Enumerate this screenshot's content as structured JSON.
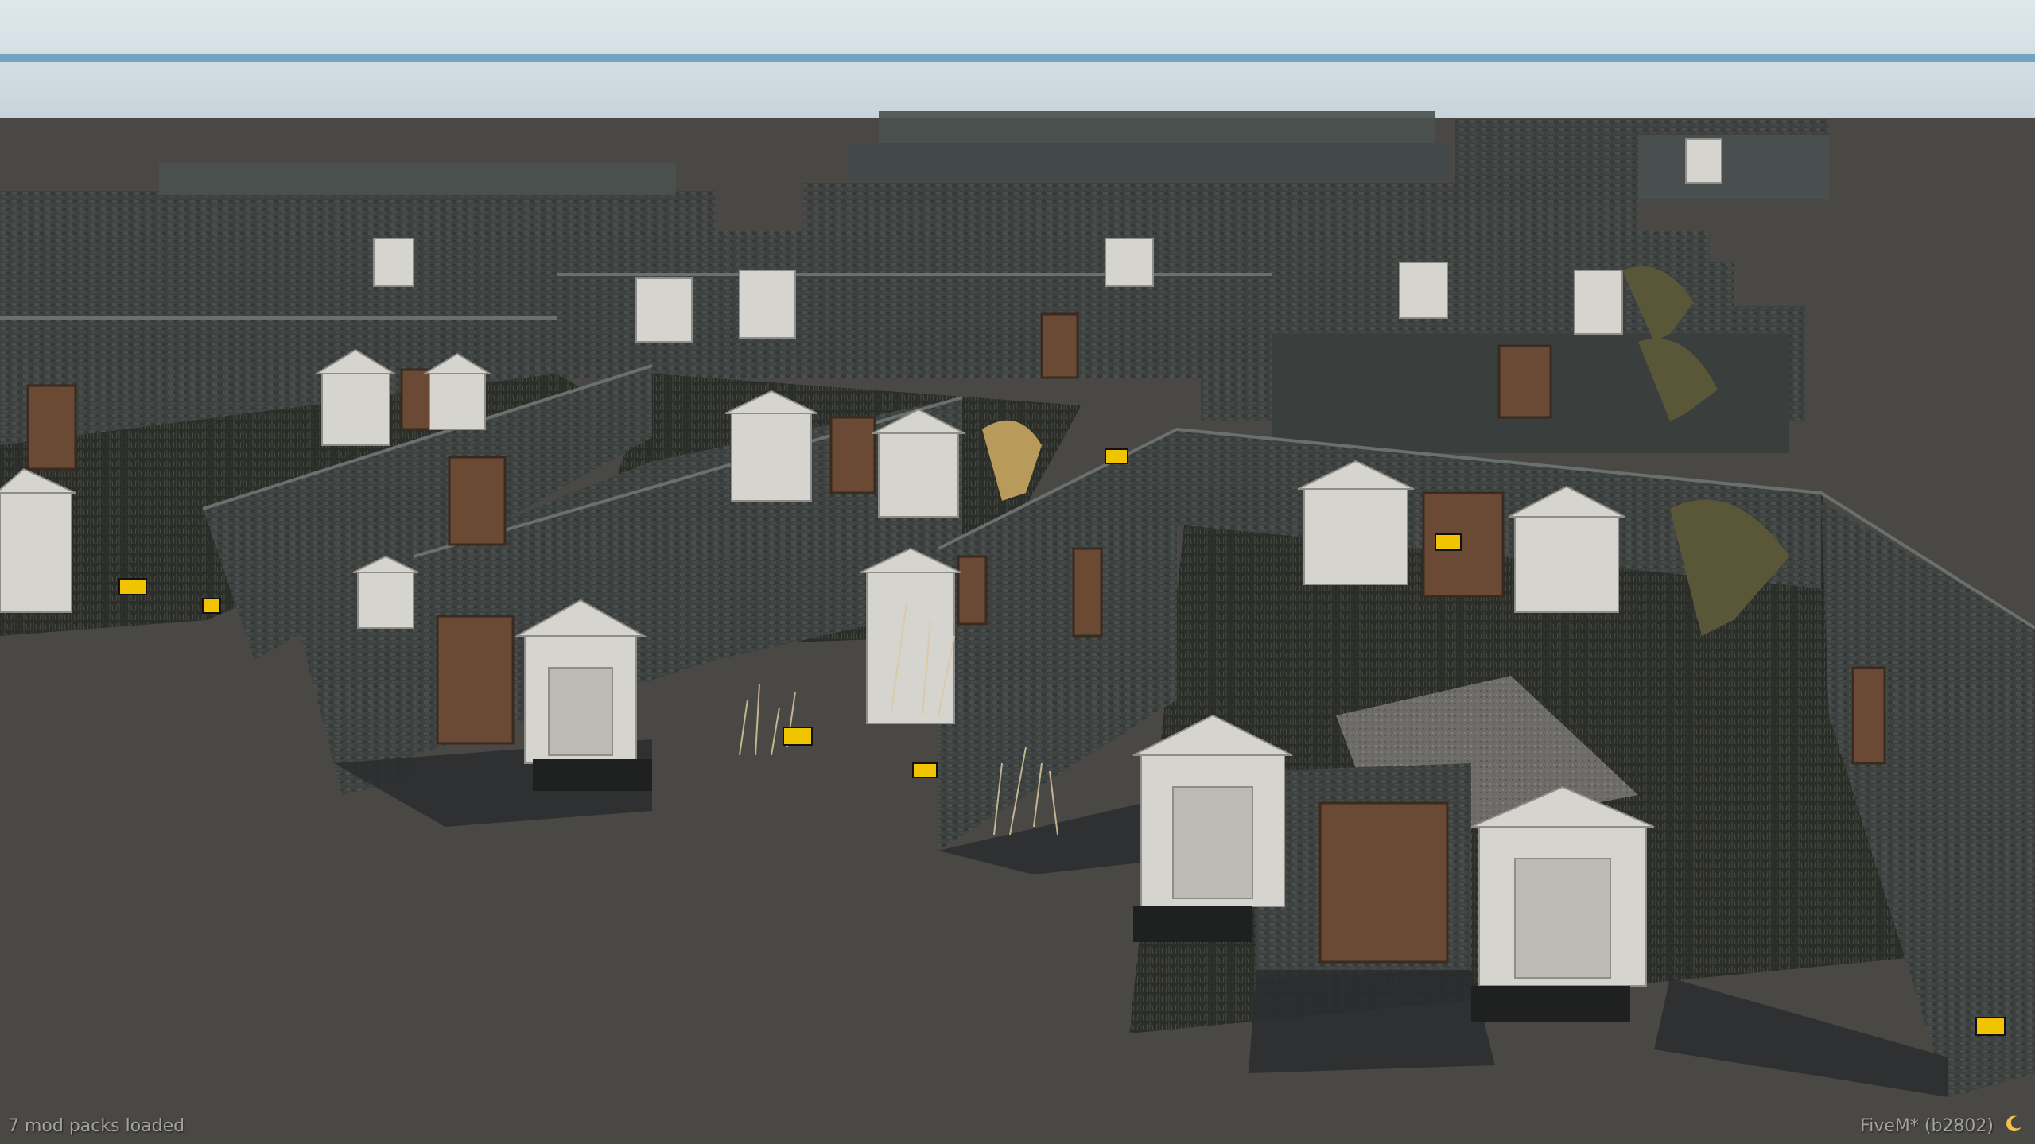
{
  "hud": {
    "mod_status": "7 mod packs loaded",
    "build_label": "FiveM* (b2802)",
    "status_icon": "moon-icon"
  },
  "colors": {
    "sky": "#c9d6dc",
    "horizon": "#4d89b0",
    "ground": "#4a4845",
    "wall": "#3b3f3e",
    "wall_top": "#5a605e",
    "door": "#6a4a35",
    "tomb": "#d8d6d2",
    "grass": "#2c2e2a",
    "moon": "#f2c34a"
  }
}
